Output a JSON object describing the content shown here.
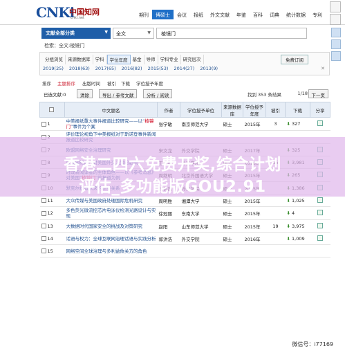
{
  "header": {
    "logo_mark": "CNKi",
    "logo_cn": "中国知网",
    "logo_sub": "cnki.net",
    "nav": [
      "期刊",
      "博硕士",
      "会议",
      "报纸",
      "外文文献",
      "年鉴",
      "百科",
      "词典",
      "统计数据",
      "专利"
    ]
  },
  "search": {
    "db_label": "文献全部分类",
    "field": "全文",
    "query": "棱镜门"
  },
  "crumb": "检索：全文:棱镜门",
  "filter": {
    "row1": [
      "分组浏览",
      "来源数据库",
      "学科",
      "学位年度",
      "基金",
      "导师",
      "学科专业",
      "研究层次"
    ],
    "manage": "免费订阅",
    "years": [
      "2019(25)",
      "2018(63)",
      "2017(65)",
      "2016(82)",
      "2015(53)",
      "2014(27)",
      "2013(9)"
    ]
  },
  "sort": {
    "label": "排序",
    "options": [
      "主题排序",
      "出版时间",
      "被引",
      "下载",
      "学位授予年度"
    ]
  },
  "actions": {
    "select": "已选文献:0",
    "clear": "清除",
    "export": "导出 / 参考文献",
    "analyze": "分析 / 阅读",
    "found": "找到 353 条结果",
    "pager": "1/18",
    "next": "下一页"
  },
  "table": {
    "headers": [
      "",
      "中文题名",
      "作者",
      "学位授予单位",
      "来源数据库",
      "学位授予年度",
      "被引",
      "下载",
      "分享"
    ],
    "rows": [
      {
        "n": "1",
        "title_a": "中美报纸重大事件报道比较研究——以“",
        "title_hl": "棱镜门",
        "title_b": "”事件为个案",
        "author": "张学敏",
        "unit": "南京师范大学",
        "db": "硕士",
        "year": "2015年",
        "cited": "3",
        "dl": "327"
      },
      {
        "n": "2",
        "title_a": "评价理论视角下中美报纸对于斯诺登",
        "title_hl": "",
        "title_b": "事件新闻报道比较研究",
        "author": "",
        "unit": "",
        "db": "",
        "year": "",
        "cited": "",
        "dl": ""
      },
      {
        "n": "7",
        "title_a": "欧盟网络安全治理研究",
        "title_hl": "",
        "title_b": "",
        "author": "宋文龙",
        "unit": "外交学院",
        "db": "硕士",
        "year": "2017年",
        "cited": "",
        "dl": "325"
      },
      {
        "n": "8",
        "title_a": "区块网络时代对美国外交决策的影响",
        "title_hl": "",
        "title_b": "",
        "author": "王蓓妍",
        "unit": "外交学院",
        "db": "博士",
        "year": "2018年",
        "cited": "16",
        "dl": "3,981"
      },
      {
        "n": "9",
        "title_a": "时政新闻译者的主体角色——以《参考消息》对美国“",
        "title_hl": "棱镜门",
        "title_b": "”的报道为例",
        "author": "周继明",
        "unit": "北京外国语大学",
        "db": "硕士",
        "year": "2015年",
        "cited": "",
        "dl": "265"
      },
      {
        "n": "10",
        "title_a": "默克尔执政以来的德美关系",
        "title_hl": "",
        "title_b": "",
        "author": "陈倩茜",
        "unit": "外交学院",
        "db": "硕士",
        "year": "2015年",
        "cited": "",
        "dl": "1,386"
      },
      {
        "n": "11",
        "title_a": "大众传媒与美国政府处理国际危机研究",
        "title_hl": "",
        "title_b": "",
        "author": "周明胜",
        "unit": "湘潭大学",
        "db": "硕士",
        "year": "2015年",
        "cited": "",
        "dl": "1,025"
      },
      {
        "n": "12",
        "title_a": "多色荧光微流控芯片电泳仪检测光路设计与实现",
        "title_hl": "",
        "title_b": "",
        "author": "徐冠丽",
        "unit": "东南大学",
        "db": "硕士",
        "year": "2015年",
        "cited": "",
        "dl": "4"
      },
      {
        "n": "13",
        "title_a": "大数据时代国家安全的挑战及对策研究",
        "title_hl": "",
        "title_b": "",
        "author": "赵阳",
        "unit": "山东师范大学",
        "db": "硕士",
        "year": "2015年",
        "cited": "19",
        "dl": "3,975"
      },
      {
        "n": "14",
        "title_a": "话语与权力：全球互联网治理话语与实践分析",
        "title_hl": "",
        "title_b": "",
        "author": "郭洪浩",
        "unit": "外交学院",
        "db": "硕士",
        "year": "2016年",
        "cited": "",
        "dl": "1,009"
      },
      {
        "n": "15",
        "title_a": "网络空间全球治理与多利益攸关方的角色",
        "title_hl": "",
        "title_b": "",
        "author": "",
        "unit": "",
        "db": "",
        "year": "",
        "cited": "",
        "dl": ""
      }
    ]
  },
  "overlay": {
    "line1": "香港二四六免费开奖,综合计划",
    "line2": "评估_多功能版GOU2.91",
    "wechat": "微信号：i77169"
  }
}
